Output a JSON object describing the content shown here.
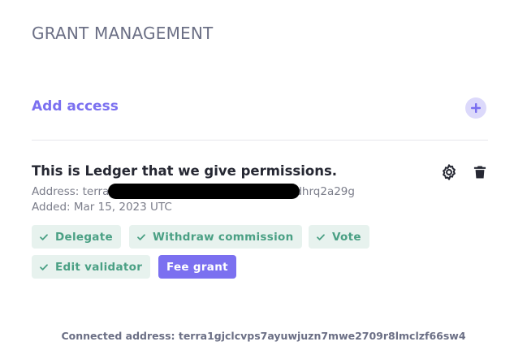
{
  "page": {
    "title": "GRANT MANAGEMENT"
  },
  "add_access": {
    "label": "Add access",
    "button_icon": "plus-icon"
  },
  "grant": {
    "title": "This is Ledger that we give permissions.",
    "address_label": "Address: terra",
    "address_suffix": "dhrq2a29g",
    "added": "Added: Mar 15, 2023 UTC",
    "actions": [
      {
        "icon": "gear-icon"
      },
      {
        "icon": "trash-icon"
      }
    ],
    "permissions": [
      {
        "label": "Delegate",
        "icon": "check-icon",
        "active": false
      },
      {
        "label": "Withdraw commission",
        "icon": "check-icon",
        "active": false
      },
      {
        "label": "Vote",
        "icon": "check-icon",
        "active": false
      },
      {
        "label": "Edit validator",
        "icon": "check-icon",
        "active": false
      },
      {
        "label": "Fee grant",
        "active": true
      }
    ]
  },
  "footer": {
    "connected_address": "Connected address: terra1gjclcvps7ayuwjuzn7mwe2709r8lmclzf66sw4"
  },
  "colors": {
    "accent": "#7b70f0",
    "accent_soft": "#dcd9fb",
    "chip_bg": "#e7f2ee",
    "chip_text": "#4aa084",
    "title_text": "#262833",
    "muted_text": "#7b7d8a",
    "header_text": "#6b6f85"
  }
}
